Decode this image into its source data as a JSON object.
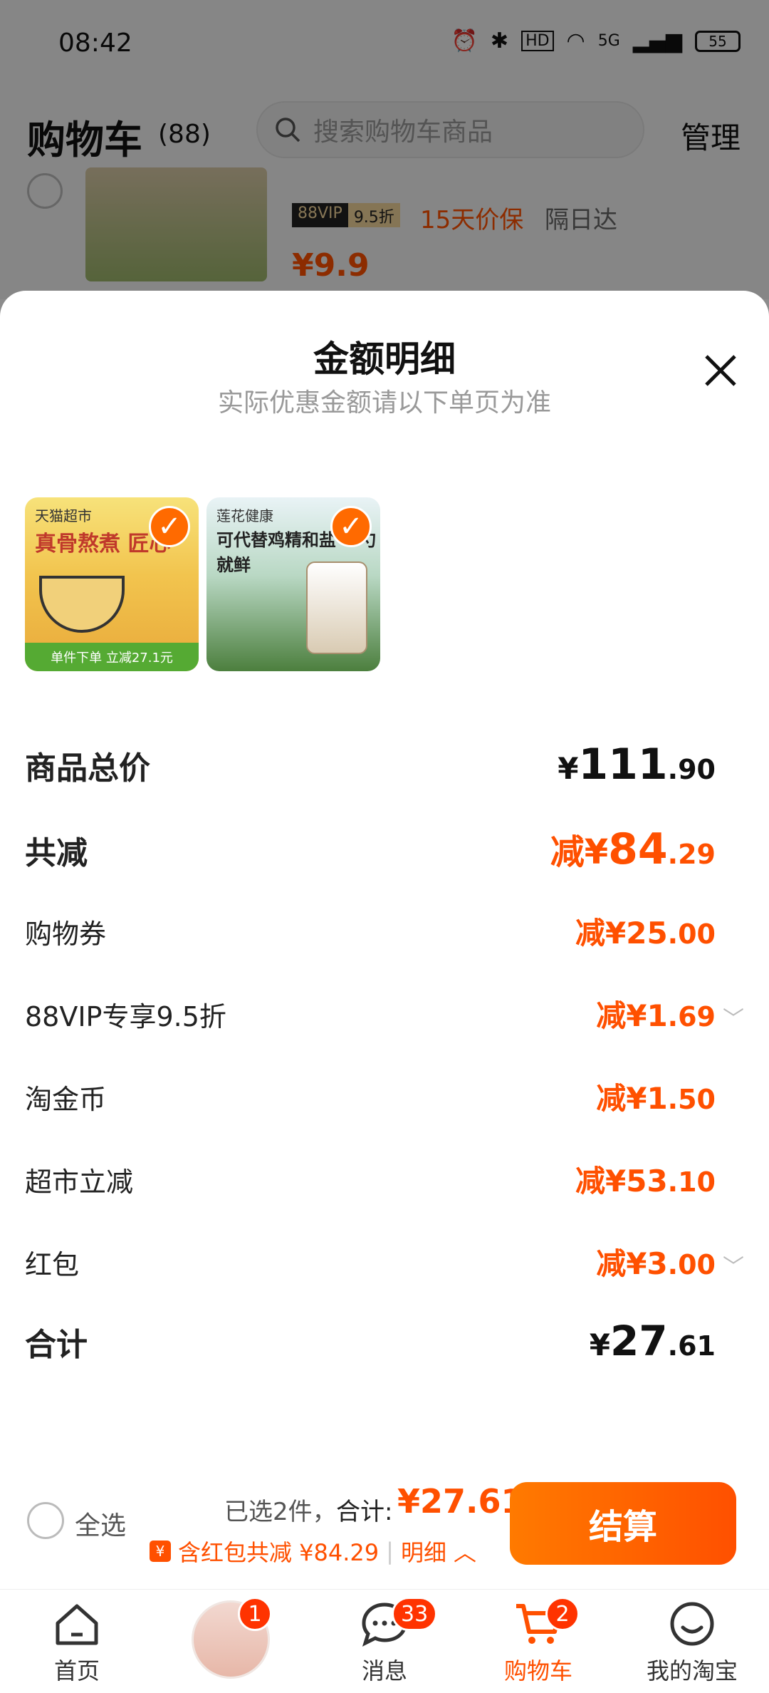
{
  "status_bar": {
    "time": "08:42",
    "network": "5G",
    "hd": "HD",
    "battery": "55"
  },
  "header": {
    "title": "购物车",
    "count": "(88)",
    "search_placeholder": "搜索购物车商品",
    "manage": "管理"
  },
  "background_item": {
    "vip_dark": "88VIP",
    "vip_light": "9.5折",
    "price_protect": "15天价保",
    "delivery": "隔日达",
    "price": "¥9.9"
  },
  "sheet": {
    "title": "金额明细",
    "subtitle": "实际优惠金额请以下单页为准",
    "products": [
      {
        "store": "天猫超市",
        "headline": "真骨熬煮 匠心",
        "band": "单件下单 立减27.1元"
      },
      {
        "store": "莲花健康",
        "headline": "可代替鸡精和盐 一勺就鲜",
        "band": ""
      }
    ],
    "rows": [
      {
        "label": "商品总价",
        "prefix": "¥",
        "int": "111",
        "dec": ".90"
      },
      {
        "label": "共减",
        "prefix": "减¥",
        "int": "84",
        "dec": ".29"
      },
      {
        "label": "购物券",
        "prefix": "减¥",
        "int": "25",
        "dec": ".00"
      },
      {
        "label": "88VIP专享9.5折",
        "prefix": "减¥",
        "int": "1",
        "dec": ".69"
      },
      {
        "label": "淘金币",
        "prefix": "减¥",
        "int": "1",
        "dec": ".50"
      },
      {
        "label": "超市立减",
        "prefix": "减¥",
        "int": "53",
        "dec": ".10"
      },
      {
        "label": "红包",
        "prefix": "减¥",
        "int": "3",
        "dec": ".00"
      },
      {
        "label": "合计",
        "prefix": "¥",
        "int": "27",
        "dec": ".61"
      }
    ]
  },
  "checkout": {
    "select_all": "全选",
    "selected": "已选2件，",
    "total_label": "合计:",
    "total": "¥27.61",
    "subline": "含红包共减 ¥84.29",
    "detail": "明细",
    "submit": "结算"
  },
  "tabbar": {
    "home": "首页",
    "center_badge": "1",
    "messages": "消息",
    "messages_badge": "33",
    "cart": "购物车",
    "cart_badge": "2",
    "mine": "我的淘宝"
  },
  "colors": {
    "accent": "#ff5000",
    "text": "#111111",
    "muted": "#999999"
  }
}
